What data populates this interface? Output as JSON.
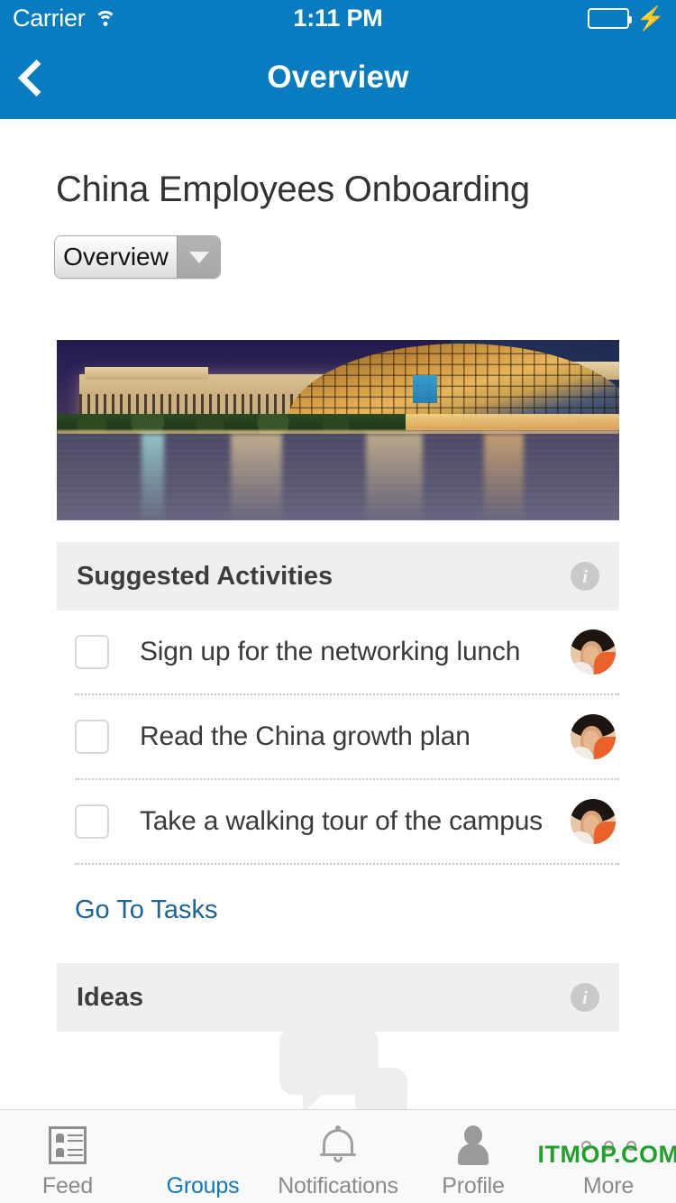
{
  "status_bar": {
    "carrier": "Carrier",
    "time": "1:11 PM",
    "wifi_icon": "wifi-icon",
    "battery_icon": "battery-icon",
    "charging_icon": "lightning-bolt-icon",
    "battery_color": "#4cd551"
  },
  "nav": {
    "title": "Overview",
    "back_icon": "chevron-left-icon",
    "bar_color": "#077cc0"
  },
  "page": {
    "title": "China Employees Onboarding",
    "view_selector": {
      "value": "Overview",
      "arrow_icon": "chevron-down-icon"
    },
    "banner": {
      "alt": "Beijing National Centre for the Performing Arts at night with water reflection"
    }
  },
  "sections": [
    {
      "title": "Suggested Activities",
      "info_icon": "info-icon",
      "info_glyph": "i",
      "tasks": [
        {
          "label": "Sign up for the networking lunch",
          "checked": false,
          "avatar": "user-avatar"
        },
        {
          "label": "Read the China growth plan",
          "checked": false,
          "avatar": "user-avatar"
        },
        {
          "label": "Take a walking tour of the campus",
          "checked": false,
          "avatar": "user-avatar"
        }
      ],
      "link": "Go To Tasks",
      "link_color": "#1a6496"
    },
    {
      "title": "Ideas",
      "info_icon": "info-icon",
      "info_glyph": "i",
      "empty_illustration": "speech-bubbles-icon"
    }
  ],
  "tabbar": {
    "active_color": "#0f79bd",
    "inactive_color": "#8a8a8a",
    "items": [
      {
        "label": "Feed",
        "icon": "feed-list-icon",
        "active": false
      },
      {
        "label": "Groups",
        "icon": "two-people-icon",
        "active": true
      },
      {
        "label": "Notifications",
        "icon": "bell-icon",
        "active": false
      },
      {
        "label": "Profile",
        "icon": "person-icon",
        "active": false
      },
      {
        "label": "More",
        "icon": "three-dots-icon",
        "active": false
      }
    ]
  },
  "watermark": {
    "text": "ITMOP.COM",
    "color": "#22a02c"
  }
}
